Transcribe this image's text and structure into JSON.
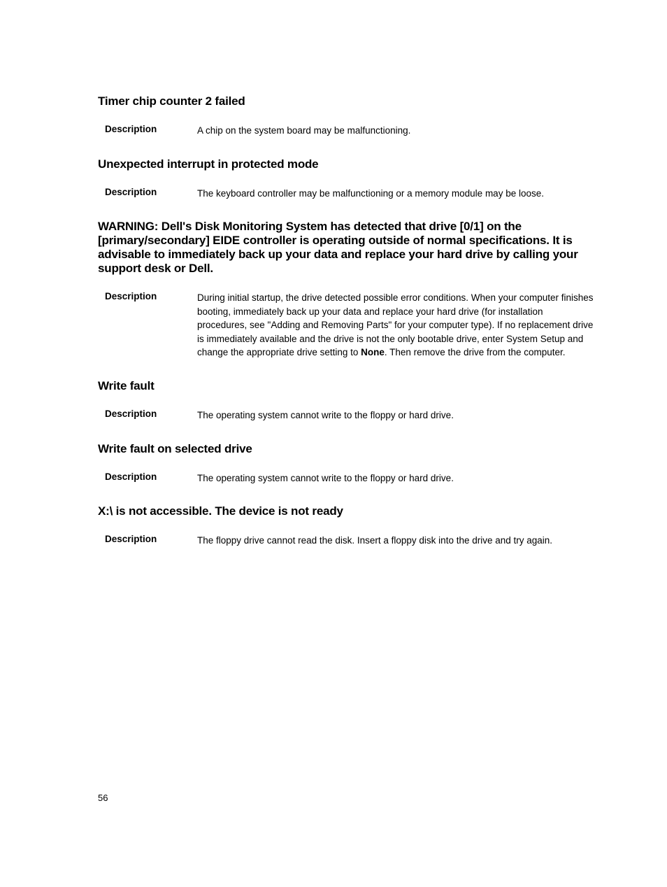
{
  "sections": [
    {
      "heading": "Timer chip counter 2 failed",
      "descLabel": "Description",
      "descText": "A chip on the system board may be malfunctioning."
    },
    {
      "heading": "Unexpected interrupt in protected mode",
      "descLabel": "Description",
      "descText": "The keyboard controller may be malfunctioning or a memory module may be loose."
    },
    {
      "heading": "WARNING: Dell's Disk Monitoring System has detected that drive [0/1] on the [primary/secondary] EIDE controller is operating outside of normal specifications. It is advisable to immediately back up your data and replace your hard drive by calling your support desk or Dell.",
      "descLabel": "Description",
      "descTextPre": "During initial startup, the drive detected possible error conditions. When your computer finishes booting, immediately back up your data and replace your hard drive (for installation procedures, see \"Adding and Removing Parts\" for your computer type). If no replacement drive is immediately available and the drive is not the only bootable drive, enter System Setup and change the appropriate drive setting to ",
      "descTextBold": "None",
      "descTextPost": ". Then remove the drive from the computer."
    },
    {
      "heading": "Write fault",
      "descLabel": "Description",
      "descText": "The operating system cannot write to the floppy or hard drive."
    },
    {
      "heading": "Write fault on selected drive",
      "descLabel": "Description",
      "descText": "The operating system cannot write to the floppy or hard drive."
    },
    {
      "heading": "X:\\ is not accessible. The device is not ready",
      "descLabel": "Description",
      "descText": "The floppy drive cannot read the disk. Insert a floppy disk into the drive and try again."
    }
  ],
  "pageNumber": "56"
}
